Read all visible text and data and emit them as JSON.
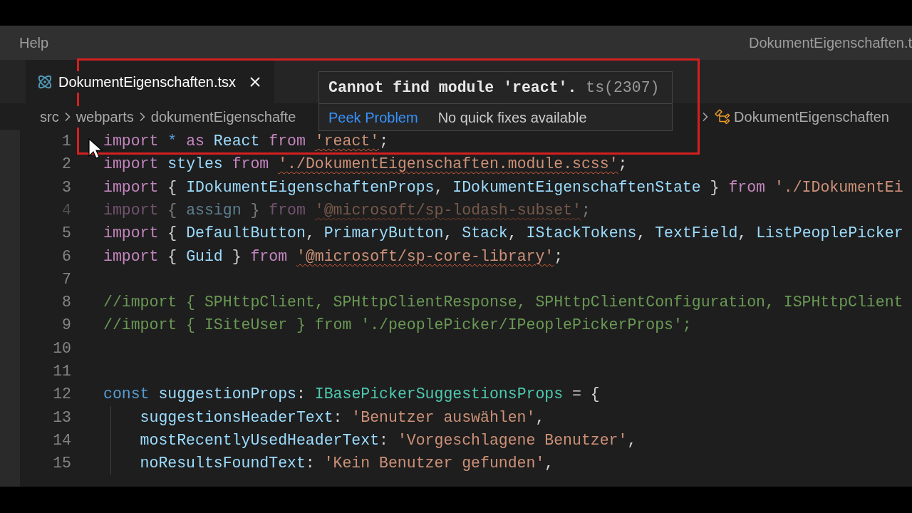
{
  "menu_bar": {
    "items": [
      {
        "label": "Help"
      }
    ],
    "window_title": "DokumentEigenschaften.t"
  },
  "tabs": [
    {
      "label": "DokumentEigenschaften.tsx",
      "selected": true
    }
  ],
  "breadcrumb": [
    {
      "label": "src",
      "kind": "folder"
    },
    {
      "label": "webparts",
      "kind": "folder"
    },
    {
      "label": "dokumentEigenschafte",
      "kind": "folder"
    },
    {
      "label": "DokumentEigenschaften",
      "kind": "symbol"
    }
  ],
  "hover": {
    "message": "Cannot find module 'react'.",
    "code": "ts(2307)",
    "action": "Peek Problem",
    "note": "No quick fixes available"
  },
  "lines": [
    {
      "number": "1",
      "faded": false,
      "tokens": [
        {
          "text": "import ",
          "kind": "keyword"
        },
        {
          "text": "* ",
          "kind": "storage"
        },
        {
          "text": "as ",
          "kind": "keyword"
        },
        {
          "text": "React ",
          "kind": "variable"
        },
        {
          "text": "from ",
          "kind": "keyword"
        },
        {
          "text": "'react'",
          "kind": "string",
          "error": true
        },
        {
          "text": ";",
          "kind": "punct"
        }
      ]
    },
    {
      "number": "2",
      "faded": false,
      "tokens": [
        {
          "text": "import ",
          "kind": "keyword"
        },
        {
          "text": "styles ",
          "kind": "variable"
        },
        {
          "text": "from ",
          "kind": "keyword"
        },
        {
          "text": "'./DokumentEigenschaften.module.scss'",
          "kind": "string",
          "error": true
        },
        {
          "text": ";",
          "kind": "punct"
        }
      ]
    },
    {
      "number": "3",
      "faded": false,
      "tokens": [
        {
          "text": "import ",
          "kind": "keyword"
        },
        {
          "text": "{ ",
          "kind": "punct"
        },
        {
          "text": "IDokumentEigenschaftenProps",
          "kind": "variable"
        },
        {
          "text": ", ",
          "kind": "punct"
        },
        {
          "text": "IDokumentEigenschaftenState ",
          "kind": "variable"
        },
        {
          "text": "} ",
          "kind": "punct"
        },
        {
          "text": "from ",
          "kind": "keyword"
        },
        {
          "text": "'./IDokumentEi",
          "kind": "string"
        }
      ]
    },
    {
      "number": "4",
      "faded": true,
      "tokens": [
        {
          "text": "import ",
          "kind": "keyword"
        },
        {
          "text": "{ ",
          "kind": "punct"
        },
        {
          "text": "assign ",
          "kind": "variable"
        },
        {
          "text": "} ",
          "kind": "punct"
        },
        {
          "text": "from ",
          "kind": "keyword"
        },
        {
          "text": "'@microsoft/sp-lodash-subset'",
          "kind": "string",
          "error": true
        },
        {
          "text": ";",
          "kind": "punct"
        }
      ]
    },
    {
      "number": "5",
      "faded": false,
      "tokens": [
        {
          "text": "import ",
          "kind": "keyword"
        },
        {
          "text": "{ ",
          "kind": "punct"
        },
        {
          "text": "DefaultButton",
          "kind": "variable"
        },
        {
          "text": ", ",
          "kind": "punct"
        },
        {
          "text": "PrimaryButton",
          "kind": "variable"
        },
        {
          "text": ", ",
          "kind": "punct"
        },
        {
          "text": "Stack",
          "kind": "variable"
        },
        {
          "text": ", ",
          "kind": "punct"
        },
        {
          "text": "IStackTokens",
          "kind": "variable"
        },
        {
          "text": ", ",
          "kind": "punct"
        },
        {
          "text": "TextField",
          "kind": "variable"
        },
        {
          "text": ", ",
          "kind": "punct"
        },
        {
          "text": "ListPeoplePicker",
          "kind": "variable"
        }
      ]
    },
    {
      "number": "6",
      "faded": false,
      "tokens": [
        {
          "text": "import ",
          "kind": "keyword"
        },
        {
          "text": "{ ",
          "kind": "punct"
        },
        {
          "text": "Guid ",
          "kind": "variable"
        },
        {
          "text": "} ",
          "kind": "punct"
        },
        {
          "text": "from ",
          "kind": "keyword"
        },
        {
          "text": "'@microsoft/sp-core-library'",
          "kind": "string",
          "error": true
        },
        {
          "text": ";",
          "kind": "punct"
        }
      ]
    },
    {
      "number": "7",
      "faded": false
    },
    {
      "number": "8",
      "faded": false,
      "tokens": [
        {
          "text": "//import { SPHttpClient, SPHttpClientResponse, SPHttpClientConfiguration, ISPHttpClient",
          "kind": "comment"
        }
      ]
    },
    {
      "number": "9",
      "faded": false,
      "tokens": [
        {
          "text": "//import { ISiteUser } from './peoplePicker/IPeoplePickerProps';",
          "kind": "comment"
        }
      ]
    },
    {
      "number": "10",
      "faded": false
    },
    {
      "number": "11",
      "faded": false
    },
    {
      "number": "12",
      "faded": false,
      "tokens": [
        {
          "text": "const ",
          "kind": "storage"
        },
        {
          "text": "suggestionProps",
          "kind": "variable"
        },
        {
          "text": ": ",
          "kind": "punct"
        },
        {
          "text": "IBasePickerSuggestionsProps",
          "kind": "type"
        },
        {
          "text": " = {",
          "kind": "punct"
        }
      ],
      "children": [
        {
          "number": "13",
          "faded": false,
          "tokens": [
            {
              "text": "suggestionsHeaderText",
              "kind": "variable"
            },
            {
              "text": ": ",
              "kind": "punct"
            },
            {
              "text": "'Benutzer auswählen'",
              "kind": "string"
            },
            {
              "text": ",",
              "kind": "punct"
            }
          ]
        },
        {
          "number": "14",
          "faded": false,
          "tokens": [
            {
              "text": "mostRecentlyUsedHeaderText",
              "kind": "variable"
            },
            {
              "text": ": ",
              "kind": "punct"
            },
            {
              "text": "'Vorgeschlagene Benutzer'",
              "kind": "string"
            },
            {
              "text": ",",
              "kind": "punct"
            }
          ]
        },
        {
          "number": "15",
          "faded": false,
          "tokens": [
            {
              "text": "noResultsFoundText",
              "kind": "variable"
            },
            {
              "text": ": ",
              "kind": "punct"
            },
            {
              "text": "'Kein Benutzer gefunden'",
              "kind": "string"
            },
            {
              "text": ",",
              "kind": "punct"
            }
          ]
        }
      ]
    }
  ]
}
